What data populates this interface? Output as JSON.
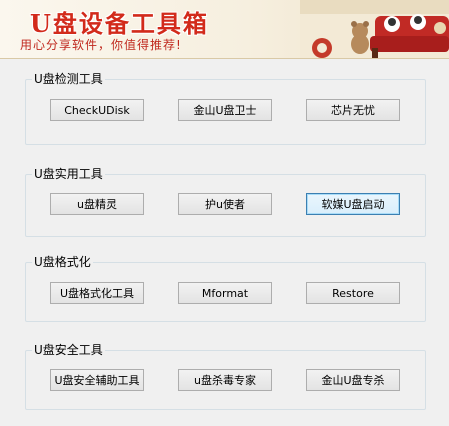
{
  "banner": {
    "title": "U盘设备工具箱",
    "slogan": "用心分享软件，你值得推荐!"
  },
  "groups": [
    {
      "title": "U盘检测工具",
      "buttons": [
        "CheckUDisk",
        "金山U盘卫士",
        "芯片无忧"
      ]
    },
    {
      "title": "U盘实用工具",
      "buttons": [
        "u盘精灵",
        "护u使者",
        "软媒U盘启动"
      ]
    },
    {
      "title": "U盘格式化",
      "buttons": [
        "U盘格式化工具",
        "Mformat",
        "Restore"
      ]
    },
    {
      "title": "U盘安全工具",
      "buttons": [
        "U盘安全辅助工具",
        "u盘杀毒专家",
        "金山U盘专杀"
      ]
    }
  ],
  "focused_button": "软媒U盘启动",
  "colors": {
    "banner_title": "#d22a1b",
    "background": "#f0f0f0",
    "sofa": "#c12a25"
  }
}
